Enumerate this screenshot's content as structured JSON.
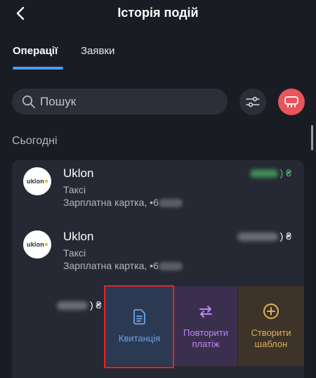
{
  "header": {
    "title": "Історія подій",
    "back_icon": "chevron-left-icon"
  },
  "tabs": [
    {
      "label": "Операції",
      "active": true
    },
    {
      "label": "Заявки",
      "active": false
    }
  ],
  "search": {
    "placeholder": "Пошук",
    "value": ""
  },
  "section": {
    "title": "Сьогодні"
  },
  "transactions": [
    {
      "merchant": "Uklon",
      "logo_text": "uklon",
      "category": "Таксі",
      "card": "Зарплатна картка, •6",
      "currency": "₴",
      "amount_color": "#53c07a"
    },
    {
      "merchant": "Uklon",
      "logo_text": "uklon",
      "category": "Таксі",
      "card": "Зарплатна картка, •6",
      "currency": "₴",
      "amount_color": "#ffffff"
    }
  ],
  "swipe_row": {
    "currency": "₴"
  },
  "actions": [
    {
      "label": "Квитанція",
      "icon": "document-icon",
      "color": "#6fa4e6"
    },
    {
      "label": "Повторити платіж",
      "icon": "repeat-icon",
      "color": "#b98af0"
    },
    {
      "label": "Створити шаблон",
      "icon": "plus-circle-icon",
      "color": "#e0b15a"
    }
  ],
  "colors": {
    "accent": "#4d9df0",
    "background": "#1a1c24",
    "avatar": "#e8555b",
    "highlight": "#e8212a"
  }
}
